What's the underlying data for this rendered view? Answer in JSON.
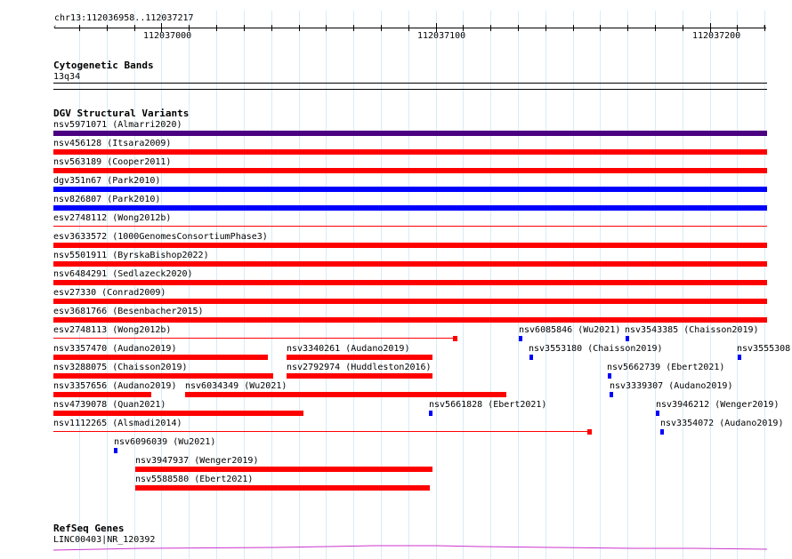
{
  "ruler": {
    "location": "chr13:112036958..112037217",
    "ticks": [
      "112037000",
      "112037100",
      "112037200"
    ]
  },
  "tracks": {
    "cytoband": {
      "title": "Cytogenetic Bands",
      "band": "13q34"
    },
    "dgv": {
      "title": "DGV Structural Variants"
    },
    "refseq": {
      "title": "RefSeq Genes",
      "gene": "LINC00403|NR_120392"
    }
  },
  "colors": {
    "gain": "#ff0000",
    "loss": "#0000ff",
    "complex": "#4b0082",
    "grid": "#d6ecf7",
    "gene": "#cc33cc"
  },
  "variants": [
    {
      "label": "nsv5971071 (Almarri2020)",
      "type": "complex"
    },
    {
      "label": "nsv456128 (Itsara2009)",
      "type": "gain"
    },
    {
      "label": "nsv563189 (Cooper2011)",
      "type": "gain"
    },
    {
      "label": "dgv351n67 (Park2010)",
      "type": "loss"
    },
    {
      "label": "nsv826807 (Park2010)",
      "type": "loss"
    },
    {
      "label": "esv2748112 (Wong2012b)",
      "type": "gain"
    },
    {
      "label": "esv3633572 (1000GenomesConsortiumPhase3)",
      "type": "gain"
    },
    {
      "label": "nsv5501911 (ByrskaBishop2022)",
      "type": "gain"
    },
    {
      "label": "nsv6484291 (Sedlazeck2020)",
      "type": "gain"
    },
    {
      "label": "esv27330 (Conrad2009)",
      "type": "gain"
    },
    {
      "label": "esv3681766 (Besenbacher2015)",
      "type": "gain"
    },
    {
      "label": "esv2748113 (Wong2012b)",
      "type": "gain"
    },
    {
      "label": "nsv6085846 (Wu2021)",
      "type": "loss"
    },
    {
      "label": "nsv3543385 (Chaisson2019)",
      "type": "loss"
    },
    {
      "label": "nsv3357470 (Audano2019)",
      "type": "gain"
    },
    {
      "label": "nsv3340261 (Audano2019)",
      "type": "gain"
    },
    {
      "label": "nsv3553180 (Chaisson2019)",
      "type": "loss"
    },
    {
      "label": "nsv3555308",
      "type": "loss"
    },
    {
      "label": "nsv3288075 (Chaisson2019)",
      "type": "gain"
    },
    {
      "label": "nsv2792974 (Huddleston2016)",
      "type": "gain"
    },
    {
      "label": "nsv5662739 (Ebert2021)",
      "type": "loss"
    },
    {
      "label": "nsv3357656 (Audano2019)",
      "type": "gain"
    },
    {
      "label": "nsv6034349 (Wu2021)",
      "type": "gain"
    },
    {
      "label": "nsv3339307 (Audano2019)",
      "type": "loss"
    },
    {
      "label": "nsv4739078 (Quan2021)",
      "type": "gain"
    },
    {
      "label": "nsv5661828 (Ebert2021)",
      "type": "loss"
    },
    {
      "label": "nsv3946212 (Wenger2019)",
      "type": "loss"
    },
    {
      "label": "nsv1112265 (Alsmadi2014)",
      "type": "gain"
    },
    {
      "label": "nsv3354072 (Audano2019)",
      "type": "loss"
    },
    {
      "label": "nsv6096039 (Wu2021)",
      "type": "loss"
    },
    {
      "label": "nsv3947937 (Wenger2019)",
      "type": "gain"
    },
    {
      "label": "nsv5588580 (Ebert2021)",
      "type": "gain"
    }
  ]
}
